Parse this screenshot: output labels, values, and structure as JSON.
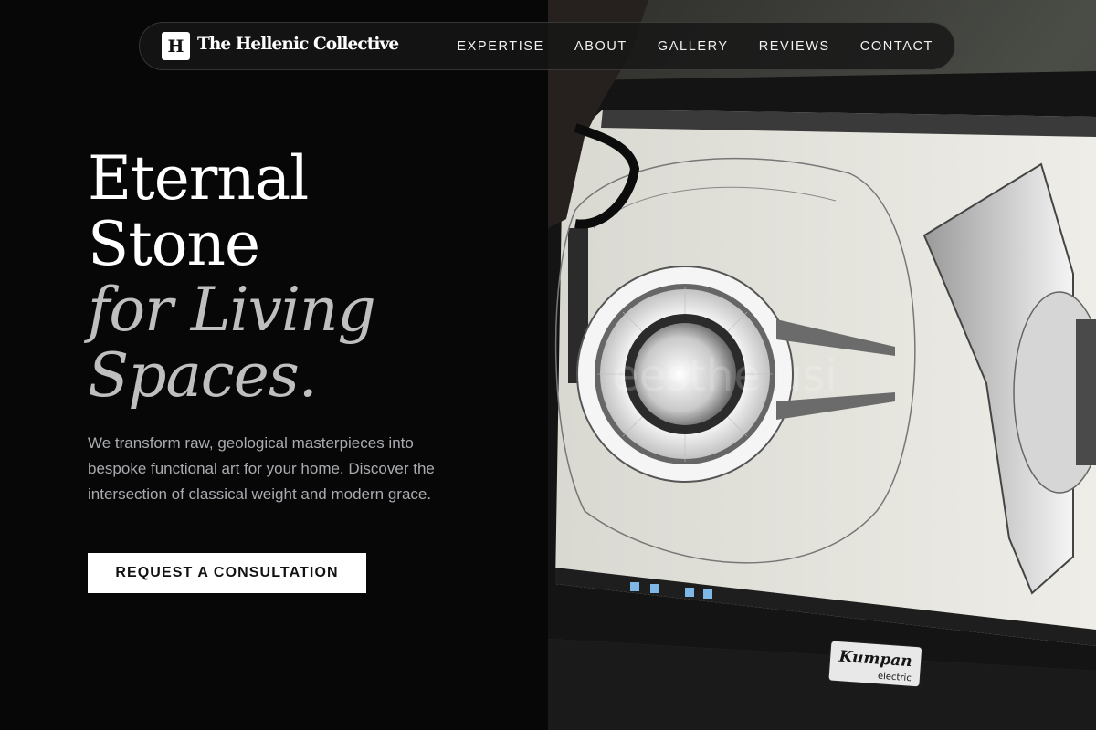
{
  "brand": {
    "mark": "H",
    "name": "The Hellenic Collective"
  },
  "nav": {
    "links": [
      "EXPERTISE",
      "ABOUT",
      "GALLERY",
      "REVIEWS",
      "CONTACT"
    ]
  },
  "hero": {
    "title_line1": "Eternal",
    "title_line2": "Stone",
    "title_line3": "for Living",
    "title_line4": "Spaces.",
    "description": "We transform raw, geological masterpieces into bespoke functional art for your home. Discover the intersection of classical weight and modern grace.",
    "cta_label": "REQUEST A CONSULTATION"
  },
  "photo": {
    "monitor_brand": "Kumpan",
    "monitor_brand_sub": "electric"
  },
  "colors": {
    "background": "#070707",
    "accent_text": "#bfbfbf",
    "body_text": "#a9abb0",
    "cta_bg": "#ffffff"
  }
}
